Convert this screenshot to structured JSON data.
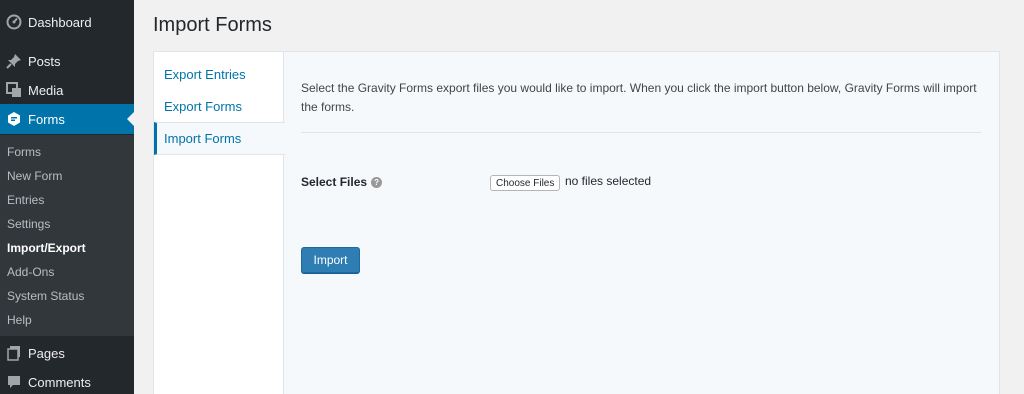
{
  "sidebar": {
    "menu": [
      {
        "label": "Dashboard",
        "icon": "dashboard-icon"
      },
      {
        "label": "Posts",
        "icon": "pin-icon"
      },
      {
        "label": "Media",
        "icon": "media-icon"
      },
      {
        "label": "Forms",
        "icon": "forms-icon"
      },
      {
        "label": "Pages",
        "icon": "pages-icon"
      },
      {
        "label": "Comments",
        "icon": "comments-icon"
      }
    ],
    "submenu": [
      "Forms",
      "New Form",
      "Entries",
      "Settings",
      "Import/Export",
      "Add-Ons",
      "System Status",
      "Help"
    ]
  },
  "page": {
    "title": "Import Forms"
  },
  "tabs": [
    "Export Entries",
    "Export Forms",
    "Import Forms"
  ],
  "import": {
    "description": "Select the Gravity Forms export files you would like to import. When you click the import button below, Gravity Forms will import the forms.",
    "field_label": "Select Files",
    "help_glyph": "?",
    "choose_button": "Choose Files",
    "file_status": "no files selected",
    "import_button": "Import"
  },
  "colors": {
    "sidebar_bg": "#23282d",
    "submenu_bg": "#32373c",
    "accent": "#0073aa",
    "button": "#2e7db3"
  }
}
